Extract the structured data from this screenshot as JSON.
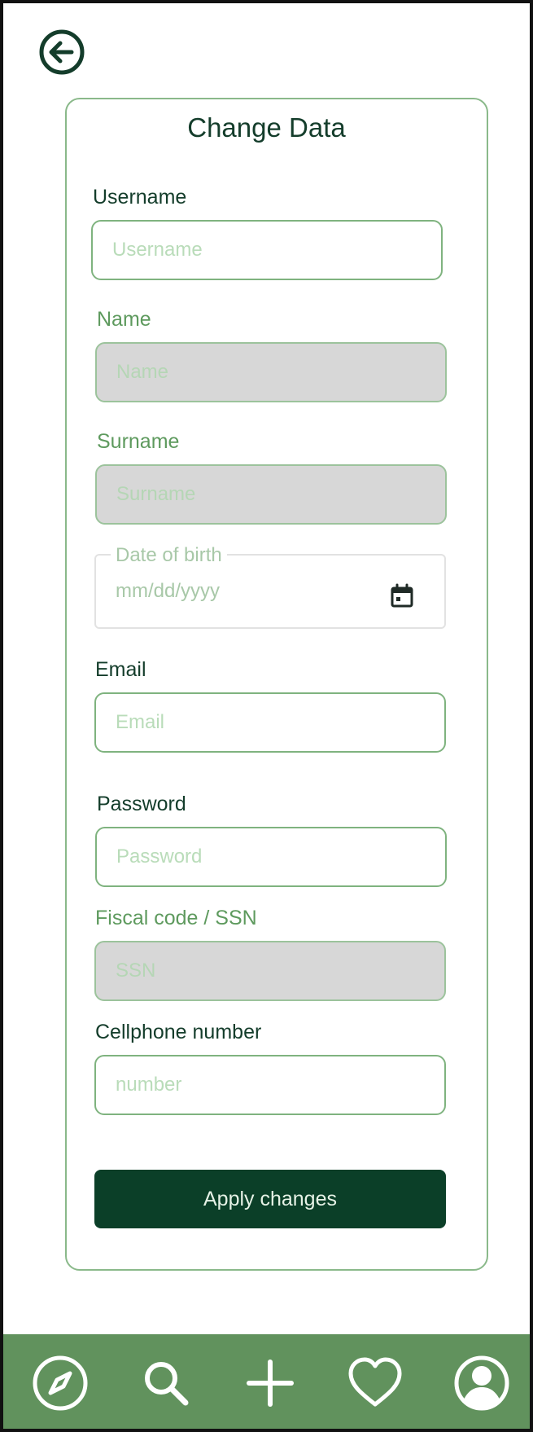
{
  "header": {
    "back_icon": "arrow-left-circle-icon"
  },
  "form": {
    "title": "Change Data",
    "username": {
      "label": "Username",
      "placeholder": "Username"
    },
    "name": {
      "label": "Name",
      "placeholder": "Name"
    },
    "surname": {
      "label": "Surname",
      "placeholder": "Surname"
    },
    "date_of_birth": {
      "label": "Date of birth",
      "value": "mm/dd/yyyy",
      "icon": "calendar-icon"
    },
    "email": {
      "label": "Email",
      "placeholder": "Email"
    },
    "password": {
      "label": "Password",
      "placeholder": "Password"
    },
    "ssn": {
      "label": "Fiscal code / SSN",
      "placeholder": "SSN"
    },
    "cellphone": {
      "label": "Cellphone number",
      "placeholder": "number"
    },
    "apply_label": "Apply changes"
  },
  "bottom_nav": {
    "items": [
      {
        "icon": "compass-icon"
      },
      {
        "icon": "search-icon"
      },
      {
        "icon": "plus-icon"
      },
      {
        "icon": "heart-icon"
      },
      {
        "icon": "user-circle-icon"
      }
    ]
  },
  "colors": {
    "primary_dark": "#0b3f28",
    "accent_green": "#61925d",
    "border_green": "#7fb37f",
    "disabled_gray": "#d7d7d7"
  }
}
